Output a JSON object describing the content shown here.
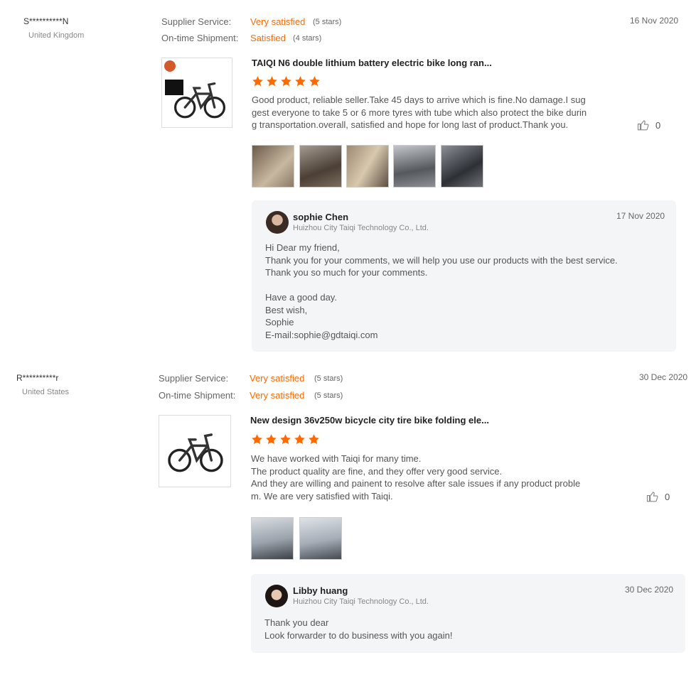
{
  "reviews": [
    {
      "user": "S**********N",
      "country": "United Kingdom",
      "supplier_label": "Supplier Service:",
      "supplier_rating": "Very satisfied",
      "supplier_stars": "(5 stars)",
      "shipment_label": "On-time Shipment:",
      "shipment_rating": "Satisfied",
      "shipment_stars": "(4 stars)",
      "date": "16 Nov 2020",
      "product_title": "TAIQI N6 double lithium battery electric bike long ran...",
      "star_count": 5,
      "text": "Good product, reliable seller.Take 45 days to arrive which is fine.No damage.I sug\ngest everyone to take 5 or 6 more tyres with tube which also protect the bike durin\ng transportation.overall, satisfied and hope for long last of product.Thank you.",
      "likes": "0",
      "reply": {
        "name": "sophie Chen",
        "company": "Huizhou City Taiqi Technology Co., Ltd.",
        "date": "17 Nov 2020",
        "text": "Hi Dear my friend,\nThank you for your comments, we will help you use our products with the best service.\nThank you so much for your comments.\n\nHave a good day.\nBest wish,\nSophie\nE-mail:sophie@gdtaiqi.com"
      }
    },
    {
      "user": "R**********r",
      "country": "United States",
      "supplier_label": "Supplier Service:",
      "supplier_rating": "Very satisfied",
      "supplier_stars": "(5 stars)",
      "shipment_label": "On-time Shipment:",
      "shipment_rating": "Very satisfied",
      "shipment_stars": "(5 stars)",
      "date": "30 Dec 2020",
      "product_title": "New design 36v250w bicycle city tire bike folding ele...",
      "star_count": 5,
      "text": "We have worked with Taiqi for many time.\nThe product quality are fine, and they offer very good service.\nAnd they are willing and painent to resolve after sale issues if any product proble\nm. We are very satisfied with Taiqi.",
      "likes": "0",
      "reply": {
        "name": "Libby huang",
        "company": "Huizhou City Taiqi Technology Co., Ltd.",
        "date": "30 Dec 2020",
        "text": "Thank you dear\nLook forwarder to do business with you again!"
      }
    }
  ],
  "colors": {
    "accent": "#ff6a00",
    "reply_bg": "#f4f5f7"
  },
  "icons": {
    "like": "thumbs-up-icon",
    "star": "star-icon"
  }
}
